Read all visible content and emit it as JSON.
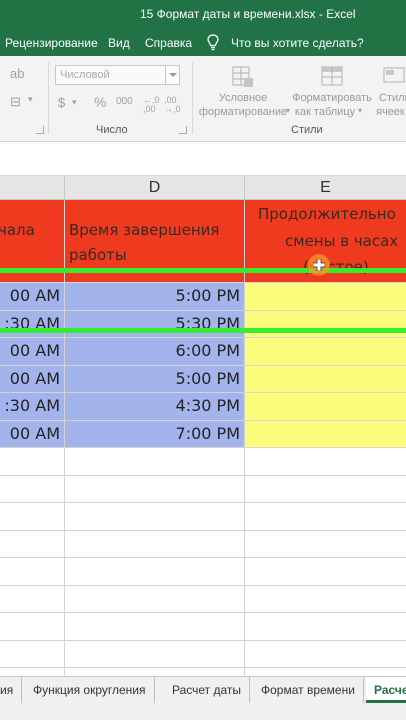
{
  "window": {
    "title": "15 Формат даты и времени.xlsx  -  Excel"
  },
  "ribbon_tabs": [
    "Рецензирование",
    "Вид",
    "Справка",
    "Что вы хотите сделать?"
  ],
  "ribbon": {
    "number_format_value": "Числовой",
    "currency_symbol": "$",
    "percent_symbol": "%",
    "comma_symbol": "000",
    "increase_decimal": "←,0 ,00",
    "decrease_decimal": ",00 →,0",
    "group_number": "Число",
    "group_styles": "Стили",
    "conditional_formatting": [
      "Условное",
      "форматирование"
    ],
    "format_as_table": [
      "Форматировать",
      "как таблицу"
    ],
    "cell_styles": [
      "Стили",
      "ячеек"
    ]
  },
  "columns": {
    "d": "D",
    "e": "E"
  },
  "headers": {
    "c": "чала",
    "d": [
      "Время завершения",
      "работы"
    ],
    "e": [
      "Продолжительно",
      "смены в часах",
      "(чистое)"
    ]
  },
  "rows": [
    {
      "c": "00 AM",
      "d": "5:00 PM",
      "e": ""
    },
    {
      "c": ":30 AM",
      "d": "5:30 PM",
      "e": ""
    },
    {
      "c": "00 AM",
      "d": "6:00 PM",
      "e": ""
    },
    {
      "c": "00 AM",
      "d": "5:00 PM",
      "e": ""
    },
    {
      "c": ":30 AM",
      "d": "4:30 PM",
      "e": ""
    },
    {
      "c": "00 AM",
      "d": "7:00 PM",
      "e": ""
    }
  ],
  "sheet_tabs": [
    "ия",
    "Функция округления",
    "Расчет даты",
    "Формат времени",
    "Расче"
  ],
  "active_sheet": "Расче",
  "colors": {
    "accent": "#217346",
    "header_fill": "#ef3a1f",
    "time_fill": "#a3b4ec",
    "result_fill": "#fbfc7b",
    "highlight": "#35ec2f"
  }
}
